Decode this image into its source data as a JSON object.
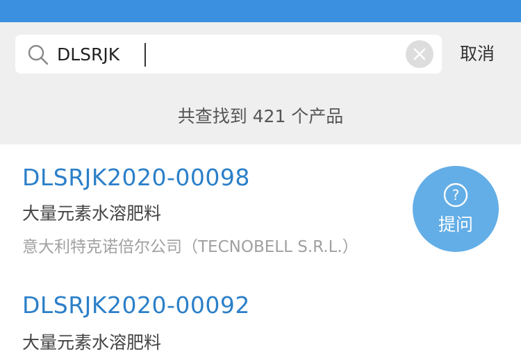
{
  "search": {
    "value": "DLSRJK",
    "icon": "search-icon",
    "clear_icon": "clear-icon"
  },
  "header": {
    "cancel_label": "取消"
  },
  "summary": {
    "text": "共查找到 421 个产品"
  },
  "results": [
    {
      "reg_no": "DLSRJK2020-00098",
      "product_type": "大量元素水溶肥料",
      "company": "意大利特克诺倍尔公司（TECNOBELL S.R.L.）"
    },
    {
      "reg_no": "DLSRJK2020-00092",
      "product_type": "大量元素水溶肥料"
    }
  ],
  "fab": {
    "label": "提问",
    "icon": "question-circle-icon"
  },
  "colors": {
    "top_bar": "#3b91e0",
    "link_blue": "#2b7fc8",
    "fab": "#5aa9e6",
    "gray_bg": "#efefef"
  }
}
